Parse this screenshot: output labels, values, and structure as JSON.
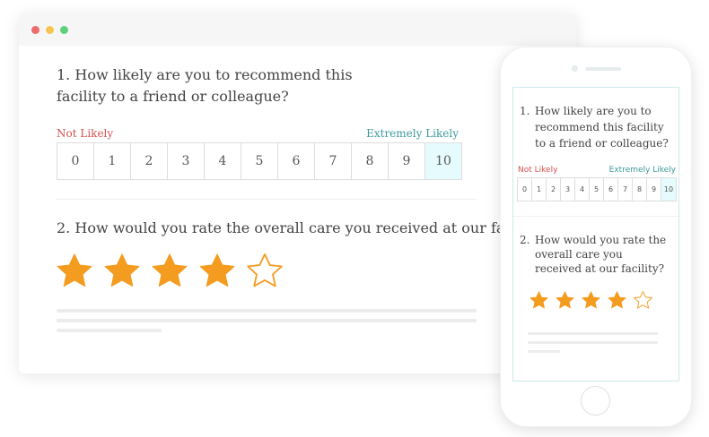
{
  "survey": {
    "question1": {
      "number": "1.",
      "text": "How likely are you to recommend this facility to a friend or colleague?",
      "label_low": "Not Likely",
      "label_high": "Extremely Likely",
      "scale": [
        "0",
        "1",
        "2",
        "3",
        "4",
        "5",
        "6",
        "7",
        "8",
        "9",
        "10"
      ],
      "selected": "10"
    },
    "question2": {
      "number": "2.",
      "text": "How would you rate the overall care you received at our facility?",
      "rating": 4,
      "max_rating": 5
    }
  },
  "colors": {
    "star_fill": "#f39c1f",
    "label_low": "#d3514f",
    "label_high": "#3c9a9a",
    "selected_cell": "#e6fbfd"
  },
  "icons": {
    "filled_star": "star-filled-icon",
    "empty_star": "star-outline-icon"
  }
}
